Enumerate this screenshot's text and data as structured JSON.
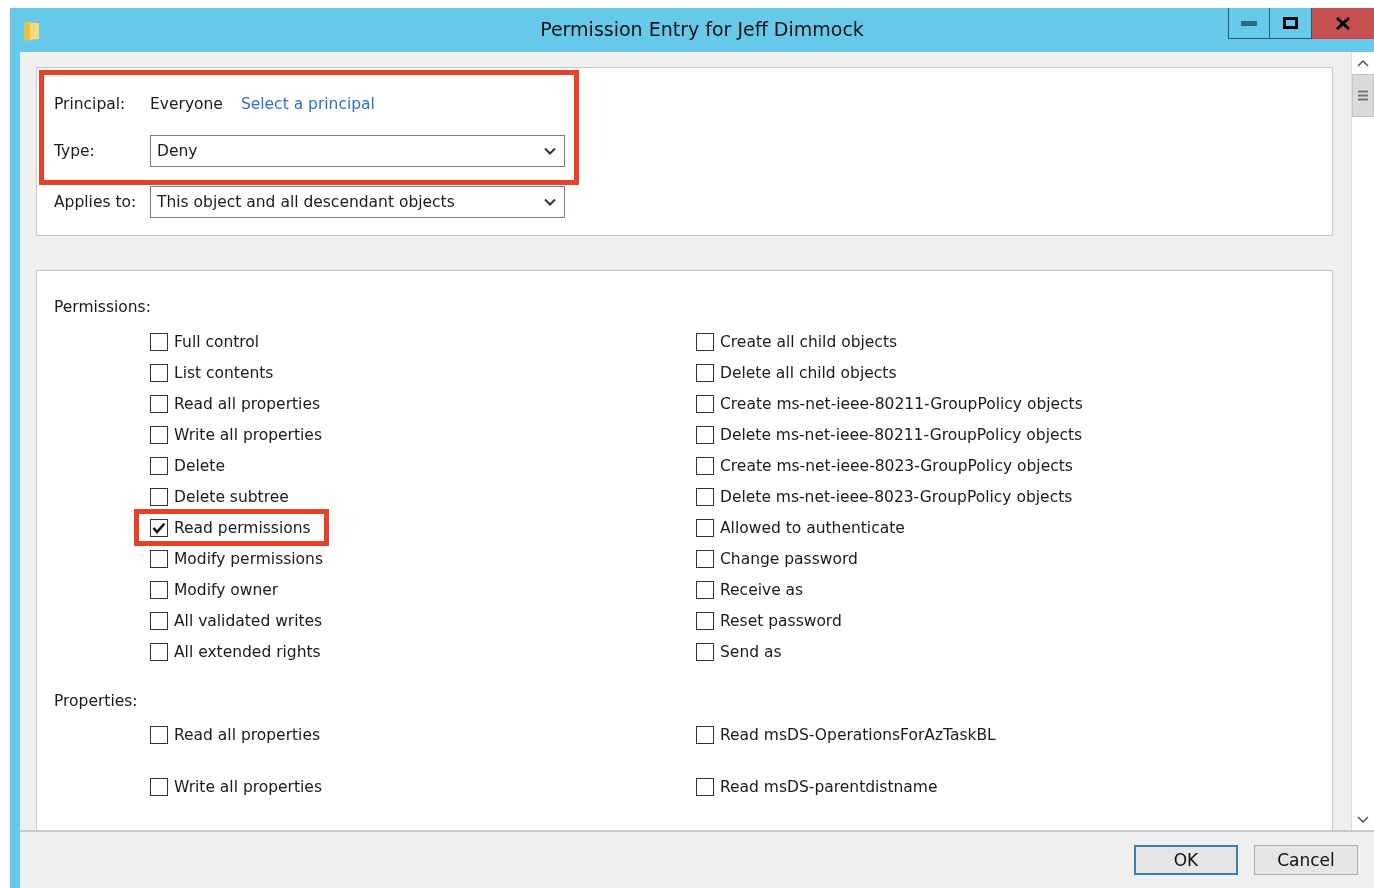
{
  "window": {
    "title": "Permission Entry for Jeff Dimmock"
  },
  "principal": {
    "label": "Principal:",
    "value": "Everyone",
    "link": "Select a principal"
  },
  "type": {
    "label": "Type:",
    "value": "Deny"
  },
  "principal_type_highlighted": true,
  "applies_to": {
    "label": "Applies to:",
    "value": "This object and all descendant objects"
  },
  "permissions": {
    "label": "Permissions:",
    "columns": [
      [
        {
          "label": "Full control",
          "checked": false,
          "highlighted": false
        },
        {
          "label": "List contents",
          "checked": false,
          "highlighted": false
        },
        {
          "label": "Read all properties",
          "checked": false,
          "highlighted": false
        },
        {
          "label": "Write all properties",
          "checked": false,
          "highlighted": false
        },
        {
          "label": "Delete",
          "checked": false,
          "highlighted": false
        },
        {
          "label": "Delete subtree",
          "checked": false,
          "highlighted": false
        },
        {
          "label": "Read permissions",
          "checked": true,
          "highlighted": true
        },
        {
          "label": "Modify permissions",
          "checked": false,
          "highlighted": false
        },
        {
          "label": "Modify owner",
          "checked": false,
          "highlighted": false
        },
        {
          "label": "All validated writes",
          "checked": false,
          "highlighted": false
        },
        {
          "label": "All extended rights",
          "checked": false,
          "highlighted": false
        }
      ],
      [
        {
          "label": "Create all child objects",
          "checked": false,
          "highlighted": false
        },
        {
          "label": "Delete all child objects",
          "checked": false,
          "highlighted": false
        },
        {
          "label": "Create ms-net-ieee-80211-GroupPolicy objects",
          "checked": false,
          "highlighted": false
        },
        {
          "label": "Delete ms-net-ieee-80211-GroupPolicy objects",
          "checked": false,
          "highlighted": false
        },
        {
          "label": "Create ms-net-ieee-8023-GroupPolicy objects",
          "checked": false,
          "highlighted": false
        },
        {
          "label": "Delete ms-net-ieee-8023-GroupPolicy objects",
          "checked": false,
          "highlighted": false
        },
        {
          "label": "Allowed to authenticate",
          "checked": false,
          "highlighted": false
        },
        {
          "label": "Change password",
          "checked": false,
          "highlighted": false
        },
        {
          "label": "Receive as",
          "checked": false,
          "highlighted": false
        },
        {
          "label": "Reset password",
          "checked": false,
          "highlighted": false
        },
        {
          "label": "Send as",
          "checked": false,
          "highlighted": false
        }
      ]
    ]
  },
  "properties": {
    "label": "Properties:",
    "columns": [
      [
        {
          "label": "Read all properties",
          "checked": false,
          "highlighted": false
        },
        {
          "label": "Write all properties",
          "checked": false,
          "highlighted": false
        }
      ],
      [
        {
          "label": "Read msDS-OperationsForAzTaskBL",
          "checked": false,
          "highlighted": false
        },
        {
          "label": "Read msDS-parentdistname",
          "checked": false,
          "highlighted": false
        }
      ]
    ]
  },
  "buttons": [
    {
      "label": "OK",
      "default": true
    },
    {
      "label": "Cancel",
      "default": false
    }
  ]
}
